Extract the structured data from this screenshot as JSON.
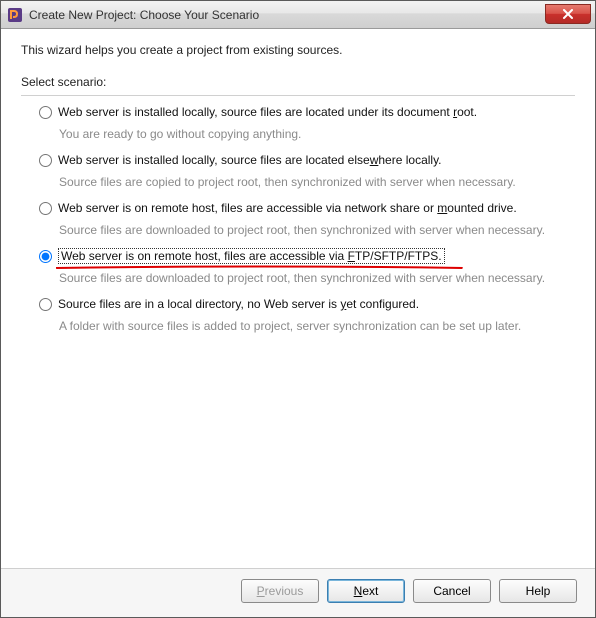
{
  "window": {
    "title": "Create New Project: Choose Your Scenario"
  },
  "intro": "This wizard helps you create a project from existing sources.",
  "select_label": "Select scenario:",
  "scenarios": [
    {
      "label_pre": "Web server is installed locally, source files are located under its document ",
      "label_ul": "r",
      "label_post": "oot.",
      "desc": "You are ready to go without copying anything."
    },
    {
      "label_pre": "Web server is installed locally, source files are located else",
      "label_ul": "w",
      "label_post": "here locally.",
      "desc": "Source files are copied to project root, then synchronized with server when necessary."
    },
    {
      "label_pre": "Web server is on remote host, files are accessible via network share or ",
      "label_ul": "m",
      "label_post": "ounted drive.",
      "desc": "Source files are downloaded to project root, then synchronized with server when necessary."
    },
    {
      "label_pre": "Web server is on remote host, files are accessible via ",
      "label_ul": "F",
      "label_post": "TP/SFTP/FTPS.",
      "desc": "Source files are downloaded to project root, then synchronized with server when necessary."
    },
    {
      "label_pre": "Source files are in a local directory, no Web server is ",
      "label_ul": "y",
      "label_post": "et configured.",
      "desc": "A folder with source files is added to project, server synchronization can be set up later."
    }
  ],
  "selected_index": 3,
  "buttons": {
    "previous_ul": "P",
    "previous_rest": "revious",
    "next_ul": "N",
    "next_rest": "ext",
    "cancel": "Cancel",
    "help": "Help"
  }
}
